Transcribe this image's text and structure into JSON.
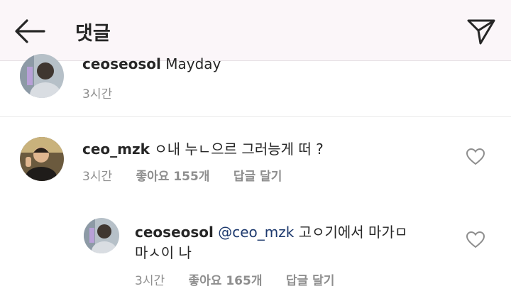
{
  "header": {
    "title": "댓글"
  },
  "comments": [
    {
      "username": "ceoseosol",
      "text": "Mayday",
      "time": "3시간"
    },
    {
      "username": "ceo_mzk",
      "text": "ㅇ내 누ㄴ으르 그러능게 떠 ?",
      "time": "3시간",
      "likes": "좋아요 155개",
      "reply": "답글 달기"
    },
    {
      "username": "ceoseosol",
      "mention": "@ceo_mzk",
      "text_line1": "고ㅇ기에서 마가ㅁ",
      "text_line2": "마ㅅ이 나",
      "time": "3시간",
      "likes": "좋아요 165개",
      "reply": "답글 달기"
    }
  ],
  "colors": {
    "header_bg": "#fbf6f9",
    "text": "#262626",
    "meta": "#8e8e8e",
    "mention": "#1e3a6e"
  }
}
